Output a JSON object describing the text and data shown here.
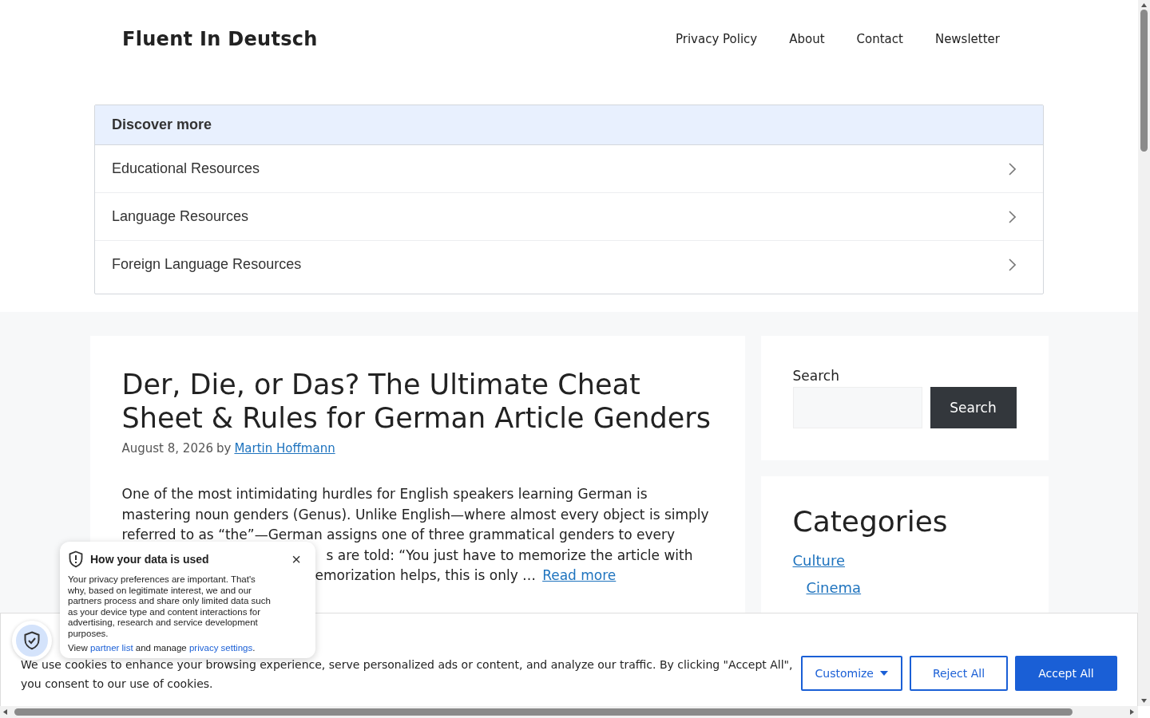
{
  "site": {
    "title": "Fluent In Deutsch",
    "nav": [
      {
        "label": "Privacy Policy"
      },
      {
        "label": "About"
      },
      {
        "label": "Contact"
      },
      {
        "label": "Newsletter"
      }
    ]
  },
  "discover": {
    "heading": "Discover more",
    "items": [
      {
        "label": "Educational Resources"
      },
      {
        "label": "Language Resources"
      },
      {
        "label": "Foreign Language Resources"
      }
    ]
  },
  "article": {
    "title": "Der, Die, or Das? The Ultimate Cheat Sheet & Rules for German Article Genders",
    "date": "August 8, 2026",
    "by": "by",
    "author": "Martin Hoffmann",
    "excerpt_lines": [
      {
        "text": "One of the most intimidating hurdles for English speakers learning German is",
        "kind": "full"
      },
      {
        "text": "mastering noun genders (Genus). Unlike English—where almost every object is simply",
        "kind": "full"
      },
      {
        "text": "referred to as “the”—German assigns one of three grammatical genders to every",
        "kind": "full"
      },
      {
        "text": "s are told: “You just have to memorize the article with",
        "kind": "partial"
      },
      {
        "text": "emorization helps, this is only …",
        "kind": "partial"
      }
    ],
    "read_more": "Read more"
  },
  "sidebar": {
    "search": {
      "label": "Search",
      "button": "Search"
    },
    "categories": {
      "heading": "Categories",
      "items": [
        {
          "label": "Culture",
          "children": [
            {
              "label": "Cinema"
            }
          ]
        }
      ]
    }
  },
  "cookie_banner": {
    "text": "We use cookies to enhance your browsing experience, serve personalized ads or content, and analyze our traffic. By clicking \"Accept All\", you consent to our use of cookies.",
    "buttons": [
      {
        "label": "Customize",
        "kind": "dropdown"
      },
      {
        "label": "Reject All",
        "kind": "outline"
      },
      {
        "label": "Accept All",
        "kind": "primary"
      }
    ]
  },
  "privacy_popup": {
    "title": "How your data is used",
    "close": "×",
    "body": "Your privacy preferences are important. That's why, based on legitimate interest, we and our partners process and share only limited data such as your device type and content interactions for advertising, research and service development purposes.",
    "footer": [
      {
        "kind": "text",
        "text": "View "
      },
      {
        "kind": "link",
        "text": "partner list"
      },
      {
        "kind": "text",
        "text": " and manage "
      },
      {
        "kind": "link",
        "text": "privacy settings"
      },
      {
        "kind": "text",
        "text": "."
      }
    ]
  }
}
